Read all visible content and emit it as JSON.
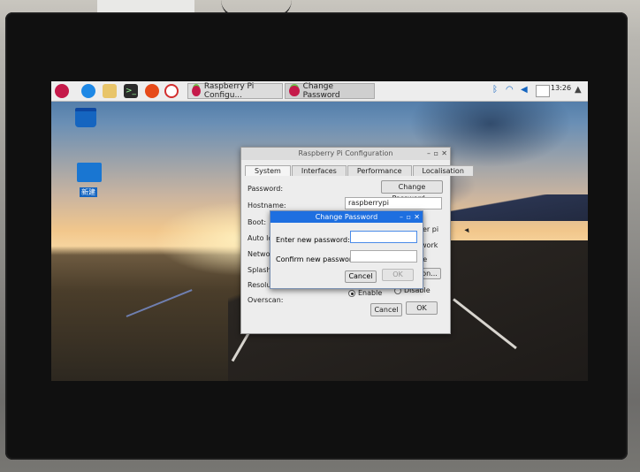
{
  "taskbar": {
    "tasks": [
      {
        "label": "Raspberry Pi Configu..."
      },
      {
        "label": "Change Password"
      }
    ],
    "clock": "13:26"
  },
  "desktop": {
    "folder_label": "新建"
  },
  "config_dialog": {
    "title": "Raspberry Pi Configuration",
    "tabs": [
      "System",
      "Interfaces",
      "Performance",
      "Localisation"
    ],
    "rows": {
      "password": "Password:",
      "hostname": "Hostname:",
      "boot": "Boot:",
      "autologin": "Auto lo",
      "network": "Networ",
      "splash": "Splash",
      "resolution": "Resolu",
      "overscan": "Overscan:"
    },
    "change_password_button": "Change Password...",
    "hostname_value": "raspberrypi",
    "right_fragments": [
      "er pi",
      "work",
      "le",
      "on..."
    ],
    "overscan_options": [
      "Enable",
      "Disable"
    ],
    "overscan_selected": "Enable",
    "cancel": "Cancel",
    "ok": "OK"
  },
  "password_dialog": {
    "title": "Change Password",
    "new_password_label": "Enter new password:",
    "confirm_password_label": "Confirm new password:",
    "new_password_value": "",
    "confirm_password_value": "",
    "cancel": "Cancel",
    "ok": "OK"
  },
  "colors": {
    "dialog_title_active": "#1e6fe0",
    "raspberry": "#c51a4a"
  }
}
